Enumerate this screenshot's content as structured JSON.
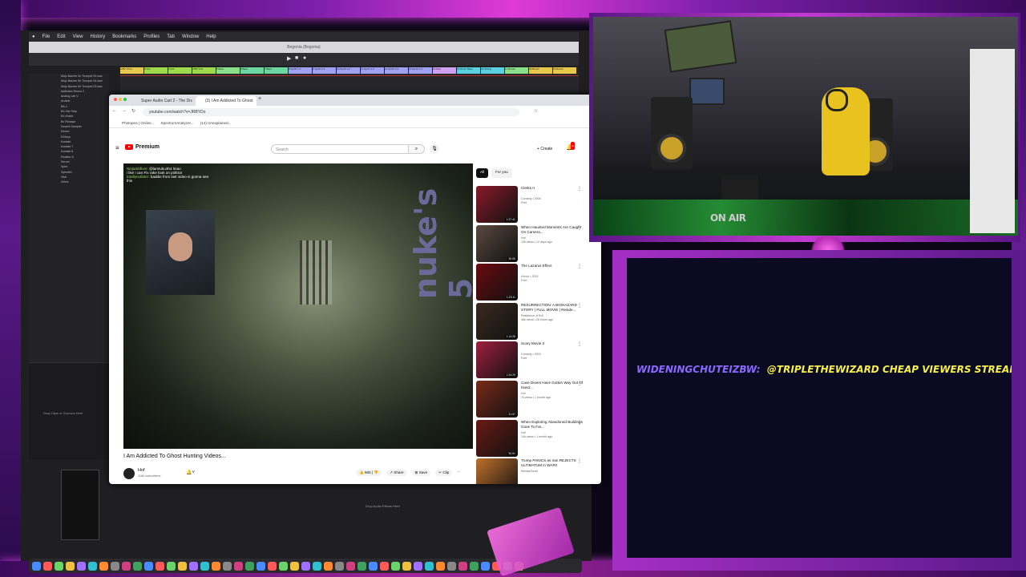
{
  "mac_menu": [
    "File",
    "Edit",
    "View",
    "History",
    "Bookmarks",
    "Profiles",
    "Tab",
    "Window",
    "Help"
  ],
  "daw": {
    "title": "Begonia (Begonia)",
    "clips": [
      {
        "label": "4 BR VOL1",
        "color": "#e8c84a"
      },
      {
        "label": "2 Vox",
        "color": "#9fd84a"
      },
      {
        "label": "3 Vox",
        "color": "#9fd84a"
      },
      {
        "label": "4 BR VOL",
        "color": "#9fd84a"
      },
      {
        "label": "5 Bass",
        "color": "#8ae08a"
      },
      {
        "label": "6 Bass",
        "color": "#6cd6a0"
      },
      {
        "label": "7 Bass",
        "color": "#6cd6a0"
      },
      {
        "label": "8 Synth 1.3",
        "color": "#a0a0f0"
      },
      {
        "label": "9 Synth 1.3",
        "color": "#a0a0f0"
      },
      {
        "label": "10 Synth 1.2",
        "color": "#a0a0f0"
      },
      {
        "label": "11 Synth 1.3",
        "color": "#a0a0f0"
      },
      {
        "label": "12 Synth 1.3",
        "color": "#a0a0f0"
      },
      {
        "label": "13 Synth 1.3",
        "color": "#a0a0f0"
      },
      {
        "label": "14 Swe",
        "color": "#d0a0f0"
      },
      {
        "label": "15 Strum Bass",
        "color": "#5ad0e0"
      },
      {
        "label": "16 Strong",
        "color": "#5ad0e0"
      },
      {
        "label": "17 Return",
        "color": "#8ae08a"
      },
      {
        "label": "18 Return",
        "color": "#e8c84a"
      },
      {
        "label": "19 Return",
        "color": "#e8c84a"
      }
    ],
    "browser_items": [
      "Mojo Bacher 0e Trumpet 09.wav",
      "Mojo Bacher 0e Trumpet 04.wav",
      "Mojo Bacher 0e Trumpet 03.wav",
      "Addictive Drums 2",
      "Analog Lab V",
      "Arcade",
      "BA-1",
      "BX-Sat Strip",
      "BX-Rolbtr",
      "Bx Rinosse",
      "Decent Sampler",
      "Dexed",
      "EZkeys",
      "Kontakt",
      "Kontakt 7",
      "Kontakt 8",
      "Reaktor 6",
      "Serum",
      "Spire",
      "Sylenth1",
      "Vital",
      "Zebra"
    ],
    "drop_clips": "Drop Clips or Grooves Here",
    "drop_effects": "Drop Audio Effects Here"
  },
  "browser": {
    "tabs": [
      {
        "label": "Super Audio Cart 2 - The Drum"
      },
      {
        "label": "(3) I Am Addicted To Ghost"
      }
    ],
    "url": "youtube.com/watch?v=JRBYDo",
    "bookmarks": [
      "Photopea | Online...",
      "SpectrumAnalyzer...",
      "(14) Unexplained..."
    ]
  },
  "youtube": {
    "logo_text": "Premium",
    "search_placeholder": "Search",
    "create_label": "Create",
    "notification_count": "9+",
    "video": {
      "overlay_text": "nuke's 5",
      "chat_lines": [
        {
          "user": "NinjaSkifiver:",
          "text": "@lamtuku3h4 lmao"
        },
        {
          "user": "",
          "text": "i like i can Fix rake look on politics"
        },
        {
          "user": "totallynotbiter:",
          "text": "baddie from last video is gonna see this"
        }
      ],
      "title": "I Am Addicted To Ghost Hunting Videos...",
      "channel": "Hof",
      "subscribers": "116k subscribers",
      "likes": "565",
      "share_label": "Share",
      "save_label": "Save",
      "clip_label": "Clip"
    },
    "chips": [
      "All",
      "For you"
    ],
    "recommendations": [
      {
        "title": "Clerks II",
        "meta1": "Comedy • 2006",
        "meta2": "Free",
        "duration": "1:37:41",
        "color": "#8a1a2a"
      },
      {
        "title": "When Haunted Moments Are Caught On Camera...",
        "meta1": "Hof",
        "meta2": "13k views • 12 days ago",
        "duration": "35:05",
        "color": "#5a4a40"
      },
      {
        "title": "The Lazarus Effect",
        "meta1": "Horror • 2015",
        "meta2": "Free",
        "duration": "1:23:11",
        "color": "#6a0a10"
      },
      {
        "title": "RESURRECTION: A BIOHAZARD STORY | FULL MOVIE | Reside...",
        "meta1": "Residence of Evil",
        "meta2": "48k views • 26 hours ago",
        "duration": "1:14:26",
        "color": "#3a2a20"
      },
      {
        "title": "Scary Movie 3",
        "meta1": "Comedy • 2003",
        "meta2": "Free",
        "duration": "1:24:29",
        "color": "#a02040"
      },
      {
        "title": "Cave Divers Have Gotten Way Out Of Hand...",
        "meta1": "Hof",
        "meta2": "7k views • 1 month ago",
        "duration": "31:57",
        "color": "#7a2a18"
      },
      {
        "title": "When Exploring Abandoned Buildings Goes To Far...",
        "meta1": "Hof",
        "meta2": "14k views • 1 month ago",
        "duration": "30:51",
        "color": "#6a1a14"
      },
      {
        "title": "Trump PANICS as Iran REJECTS ULTIMATUM in WAR!!",
        "meta1": "MeidasTouch",
        "meta2": "",
        "duration": "",
        "color": "#c0702a"
      }
    ]
  },
  "stream": {
    "webcam_sign": "ON AIR",
    "chat_user": "WIDENINGCHUTEIZBW:",
    "chat_message": "@TRIPLETHEWIZARD CHEAP VIEWERS STREAMBOO .COM (R"
  },
  "colors": {
    "neon_pink": "#e03ad8",
    "neon_purple": "#7a1fa8",
    "youtube_red": "#ff0000"
  }
}
